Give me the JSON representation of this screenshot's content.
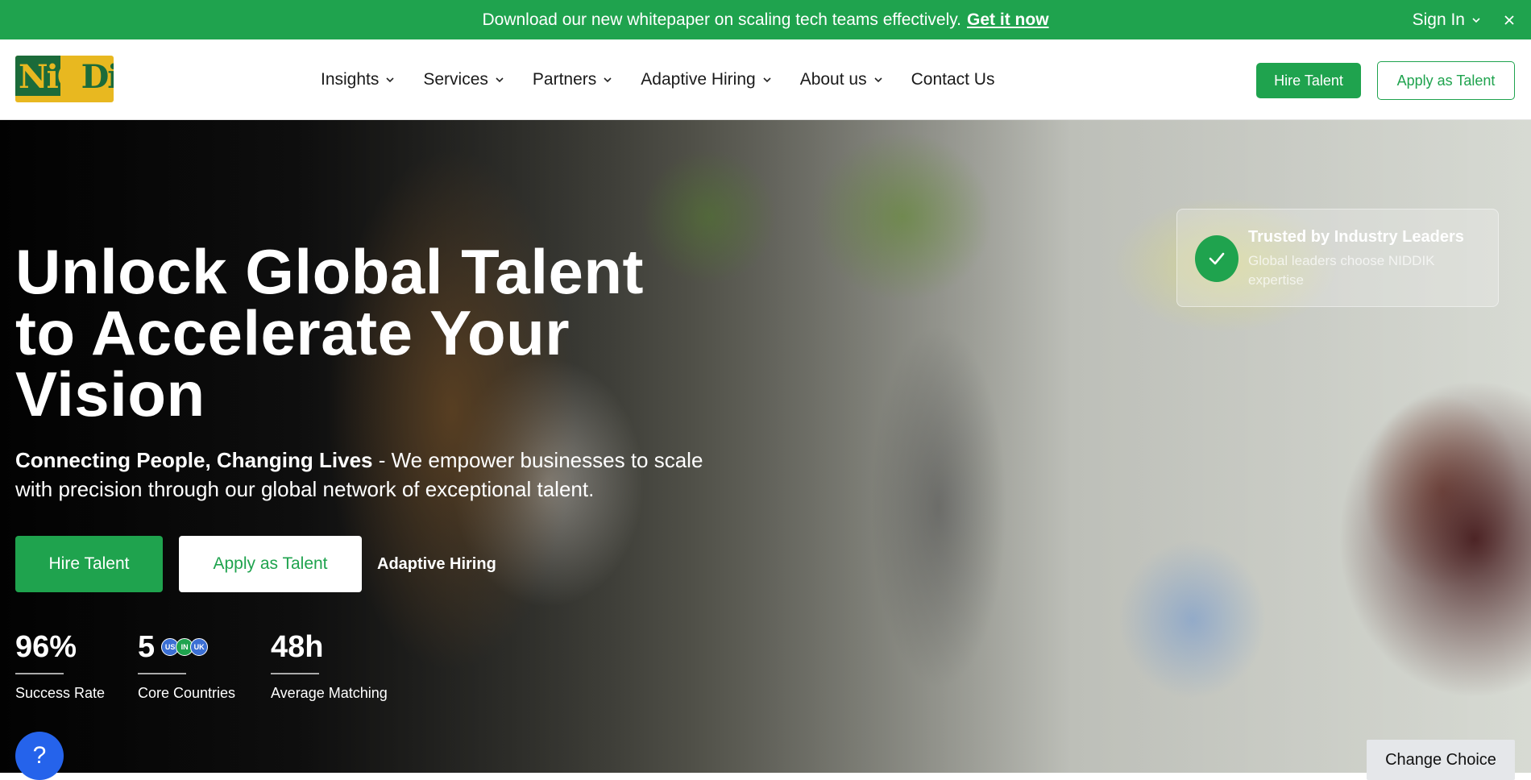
{
  "announcement": {
    "text": "Download our new whitepaper on scaling tech teams effectively.",
    "cta": "Get it now",
    "sign_in": "Sign In"
  },
  "logo": {
    "part1": "NiC",
    "part2": "DiK"
  },
  "nav": {
    "items": [
      {
        "label": "Insights",
        "dropdown": true
      },
      {
        "label": "Services",
        "dropdown": true
      },
      {
        "label": "Partners",
        "dropdown": true
      },
      {
        "label": "Adaptive Hiring",
        "dropdown": true
      },
      {
        "label": "About us",
        "dropdown": true
      },
      {
        "label": "Contact Us",
        "dropdown": false
      }
    ],
    "hire_button": "Hire Talent",
    "apply_button": "Apply as Talent"
  },
  "hero": {
    "title": "Unlock Global Talent to Accelerate Your Vision",
    "subtitle_bold": "Connecting People, Changing Lives",
    "subtitle_rest": " - We empower businesses to scale with precision through our global network of exceptional talent.",
    "hire_button": "Hire Talent",
    "apply_button": "Apply as Talent",
    "adaptive_link": "Adaptive Hiring",
    "stats": [
      {
        "value": "96%",
        "label": "Success Rate"
      },
      {
        "value": "5",
        "label": "Core Countries"
      },
      {
        "value": "48h",
        "label": "Average Matching"
      }
    ],
    "flags": [
      {
        "code": "US",
        "color": "#3b6fd4"
      },
      {
        "code": "IN",
        "color": "#1fa34e"
      },
      {
        "code": "UK",
        "color": "#3b6fd4"
      }
    ]
  },
  "trusted": {
    "title": "Trusted by Industry Leaders",
    "desc": "Global leaders choose NIDDIK expertise"
  },
  "help": {
    "label": "?"
  },
  "change_choice": "Change Choice",
  "colors": {
    "brand_green": "#1fa34e",
    "help_blue": "#2563eb"
  }
}
